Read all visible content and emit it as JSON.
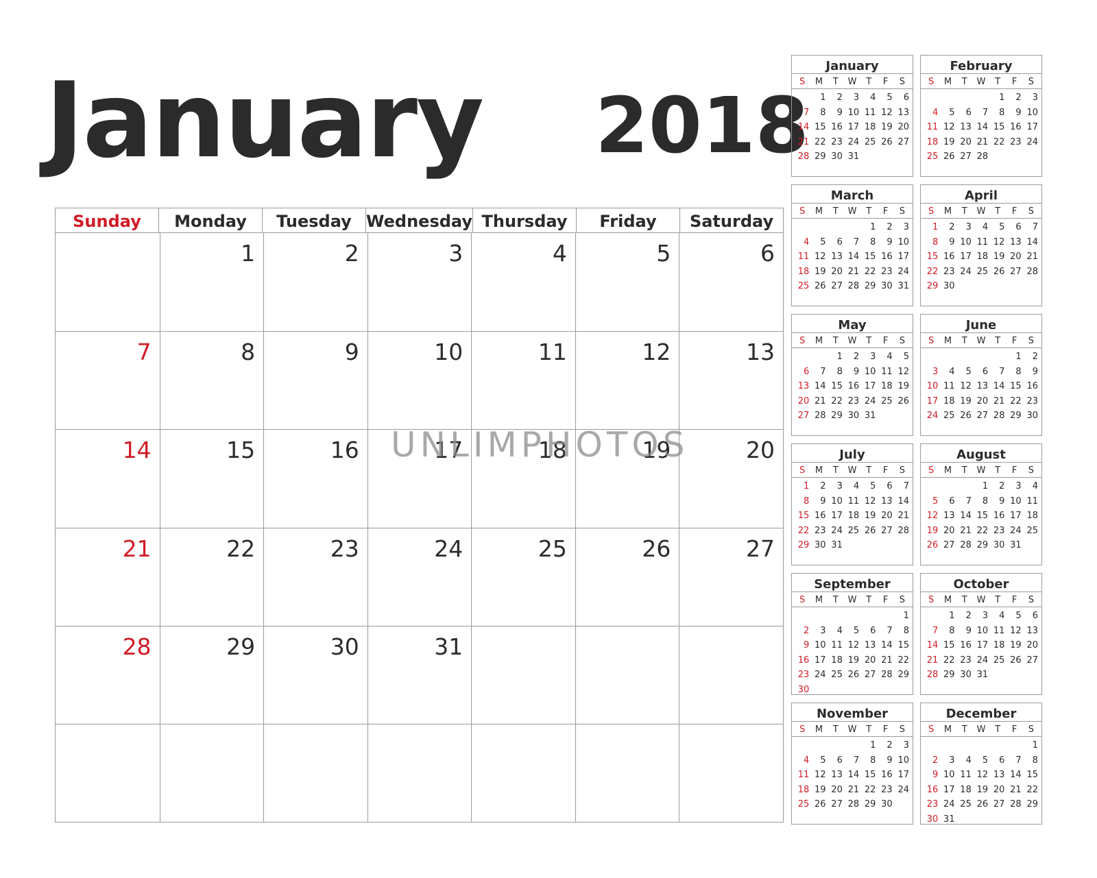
{
  "header": {
    "month": "January",
    "year": "2018"
  },
  "colors": {
    "sunday": "#d01c26",
    "text": "#2b2b2b",
    "grid": "#9a9a9a"
  },
  "main": {
    "weekdays": [
      "Sunday",
      "Monday",
      "Tuesday",
      "Wednesday",
      "Thursday",
      "Friday",
      "Saturday"
    ],
    "first_weekday": 1,
    "days_in_month": 31,
    "rows": 6
  },
  "watermark": "UNLIMPHOTOS",
  "mini_dow": [
    "S",
    "M",
    "T",
    "W",
    "T",
    "F",
    "S"
  ],
  "mini_months": [
    {
      "name": "January",
      "start": 1,
      "days": 31
    },
    {
      "name": "February",
      "start": 4,
      "days": 28
    },
    {
      "name": "March",
      "start": 4,
      "days": 31
    },
    {
      "name": "April",
      "start": 0,
      "days": 30
    },
    {
      "name": "May",
      "start": 2,
      "days": 31
    },
    {
      "name": "June",
      "start": 5,
      "days": 30
    },
    {
      "name": "July",
      "start": 0,
      "days": 31
    },
    {
      "name": "August",
      "start": 3,
      "days": 31
    },
    {
      "name": "September",
      "start": 6,
      "days": 30
    },
    {
      "name": "October",
      "start": 1,
      "days": 31
    },
    {
      "name": "November",
      "start": 4,
      "days": 30
    },
    {
      "name": "December",
      "start": 6,
      "days": 31
    }
  ]
}
